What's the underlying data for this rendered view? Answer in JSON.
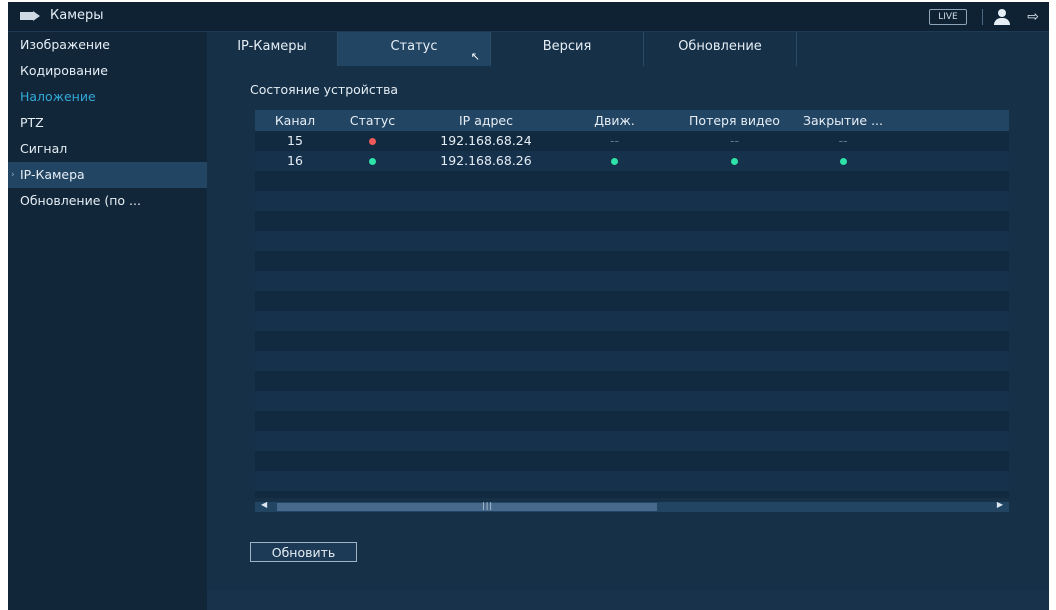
{
  "top": {
    "title": "Камеры",
    "live_label": "LIVE"
  },
  "sidebar": {
    "items": [
      {
        "label": "Изображение"
      },
      {
        "label": "Кодирование"
      },
      {
        "label": "Наложение"
      },
      {
        "label": "PTZ"
      },
      {
        "label": "Сигнал"
      },
      {
        "label": "IP-Камера"
      },
      {
        "label": "Обновление (по ..."
      }
    ]
  },
  "tabs": [
    {
      "label": "IP-Камеры"
    },
    {
      "label": "Статус"
    },
    {
      "label": "Версия"
    },
    {
      "label": "Обновление"
    }
  ],
  "section_title": "Состояние устройства",
  "table": {
    "headers": [
      "Канал",
      "Статус",
      "IP адрес",
      "Движ.",
      "Потеря видео",
      "Закрытие ..."
    ],
    "rows": [
      {
        "channel": "15",
        "status": "red",
        "ip": "192.168.68.24",
        "motion": "--",
        "video_loss": "--",
        "tamper": "--"
      },
      {
        "channel": "16",
        "status": "green",
        "ip": "192.168.68.26",
        "motion": "green",
        "video_loss": "green",
        "tamper": "green"
      }
    ]
  },
  "refresh_label": "Обновить",
  "colors": {
    "status_red": "#f05a5a",
    "status_green": "#2ee3a7",
    "accent": "#33a9d8"
  }
}
